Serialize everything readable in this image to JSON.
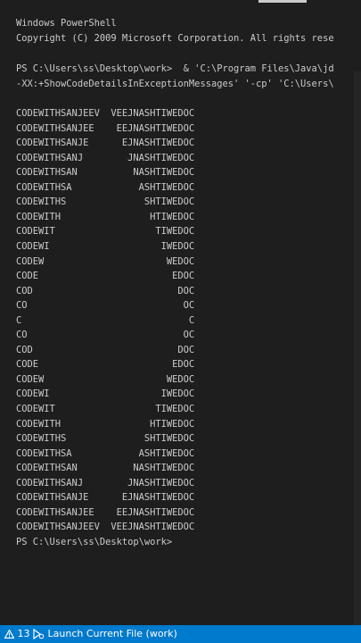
{
  "terminal": {
    "lines": [
      "Windows PowerShell",
      "Copyright (C) 2009 Microsoft Corporation. All rights rese",
      "",
      "PS C:\\Users\\ss\\Desktop\\work>  & 'C:\\Program Files\\Java\\jd",
      "-XX:+ShowCodeDetailsInExceptionMessages' '-cp' 'C:\\Users\\",
      "",
      "CODEWITHSANJEEV  VEEJNASHTIWEDOC",
      "CODEWITHSANJEE    EEJNASHTIWEDOC",
      "CODEWITHSANJE      EJNASHTIWEDOC",
      "CODEWITHSANJ        JNASHTIWEDOC",
      "CODEWITHSAN          NASHTIWEDOC",
      "CODEWITHSA            ASHTIWEDOC",
      "CODEWITHS              SHTIWEDOC",
      "CODEWITH                HTIWEDOC",
      "CODEWIT                  TIWEDOC",
      "CODEWI                    IWEDOC",
      "CODEW                      WEDOC",
      "CODE                        EDOC",
      "COD                          DOC",
      "CO                            OC",
      "C                              C",
      "CO                            OC",
      "COD                          DOC",
      "CODE                        EDOC",
      "CODEW                      WEDOC",
      "CODEWI                    IWEDOC",
      "CODEWIT                  TIWEDOC",
      "CODEWITH                HTIWEDOC",
      "CODEWITHS              SHTIWEDOC",
      "CODEWITHSA            ASHTIWEDOC",
      "CODEWITHSAN          NASHTIWEDOC",
      "CODEWITHSANJ        JNASHTIWEDOC",
      "CODEWITHSANJE      EJNASHTIWEDOC",
      "CODEWITHSANJEE    EEJNASHTIWEDOC",
      "CODEWITHSANJEEV  VEEJNASHTIWEDOC",
      "PS C:\\Users\\ss\\Desktop\\work>"
    ]
  },
  "statusbar": {
    "warnings_count": "13",
    "launch_label": "Launch Current File (work)"
  },
  "colors": {
    "terminal_bg": "#1e1e1e",
    "text": "#cccccc",
    "statusbar_bg": "#007acc"
  },
  "icons": [
    "warning-icon",
    "debug-run-icon"
  ]
}
